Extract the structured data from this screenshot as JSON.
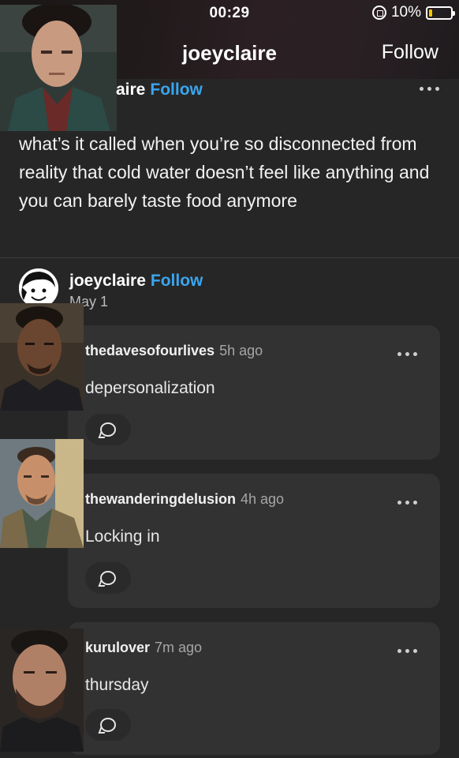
{
  "status_bar": {
    "time": "00:29",
    "battery": "10%"
  },
  "header": {
    "title": "joeyclaire",
    "follow_label": "Follow"
  },
  "post": {
    "author_partial": "aire",
    "follow_label": "Follow",
    "text": "what’s it called when you’re so disconnected from reality that cold water doesn’t feel like anything and you can barely taste food anymore"
  },
  "reblog": {
    "username": "joeyclaire",
    "follow_label": "Follow",
    "date": "May 1"
  },
  "notes": [
    {
      "username": "thedavesofourlives",
      "time": "5h ago",
      "body": "depersonalization"
    },
    {
      "username": "thewanderingdelusion",
      "time": "4h ago",
      "body": "Locking in"
    },
    {
      "username": "kurulover",
      "time": "7m ago",
      "body": "thursday"
    }
  ],
  "colors": {
    "accent": "#3aa6f0",
    "background": "#262626",
    "card": "#323232"
  },
  "icons": [
    "alarm-lock-icon",
    "battery-icon",
    "more-dots-icon",
    "reply-bubble-icon"
  ]
}
